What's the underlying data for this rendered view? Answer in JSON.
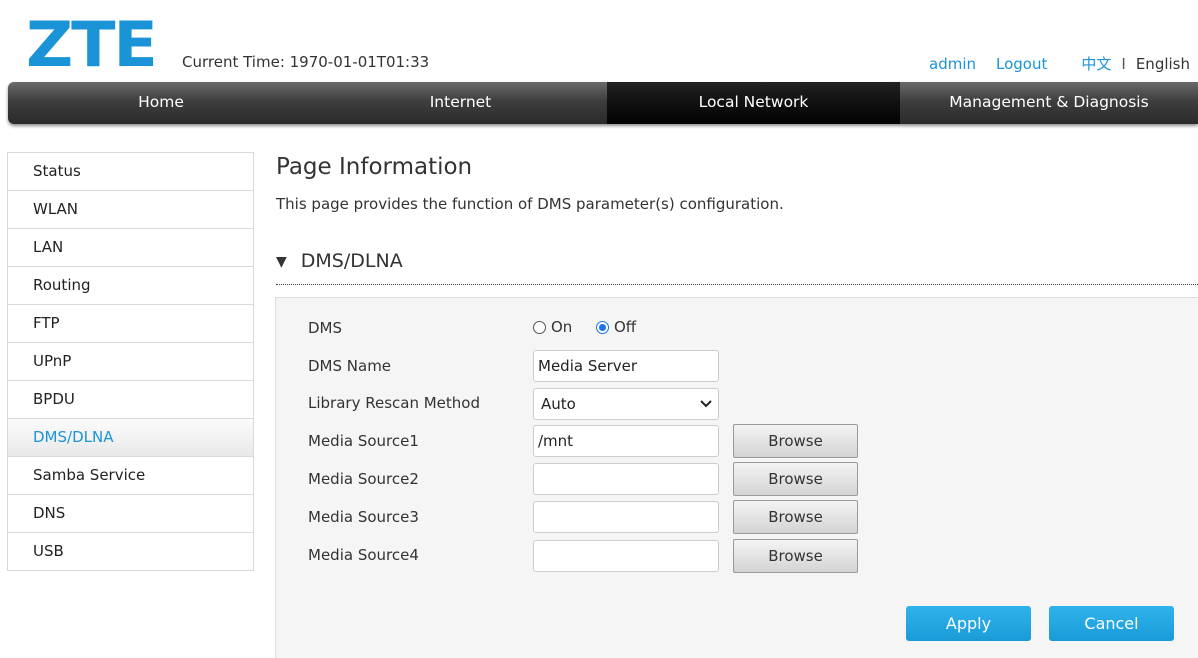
{
  "header": {
    "logo_text": "ZTE",
    "current_time": "Current Time: 1970-01-01T01:33",
    "user": "admin",
    "logout": "Logout",
    "lang_cn": "中文",
    "lang_sep": "I",
    "lang_en": "English"
  },
  "nav": {
    "items": [
      {
        "label": "Home"
      },
      {
        "label": "Internet"
      },
      {
        "label": "Local Network"
      },
      {
        "label": "Management & Diagnosis"
      }
    ],
    "active": "Local Network"
  },
  "sidebar": {
    "items": [
      {
        "label": "Status"
      },
      {
        "label": "WLAN"
      },
      {
        "label": "LAN"
      },
      {
        "label": "Routing"
      },
      {
        "label": "FTP"
      },
      {
        "label": "UPnP"
      },
      {
        "label": "BPDU"
      },
      {
        "label": "DMS/DLNA"
      },
      {
        "label": "Samba Service"
      },
      {
        "label": "DNS"
      },
      {
        "label": "USB"
      }
    ],
    "active": "DMS/DLNA"
  },
  "page": {
    "title": "Page Information",
    "description": "This page provides the function of DMS parameter(s) configuration.",
    "section_title": "DMS/DLNA"
  },
  "form": {
    "dms_label": "DMS",
    "dms_on": "On",
    "dms_off": "Off",
    "dms_selected": "Off",
    "dms_name_label": "DMS Name",
    "dms_name_value": "Media Server",
    "rescan_label": "Library Rescan Method",
    "rescan_value": "Auto",
    "source1_label": "Media Source1",
    "source1_value": "/mnt",
    "source2_label": "Media Source2",
    "source2_value": "",
    "source3_label": "Media Source3",
    "source3_value": "",
    "source4_label": "Media Source4",
    "source4_value": "",
    "browse_label": "Browse",
    "apply_label": "Apply",
    "cancel_label": "Cancel"
  },
  "colors": {
    "accent": "#1a94d6",
    "button": "#1a9bd8",
    "nav_dark": "#2a2a2a"
  }
}
